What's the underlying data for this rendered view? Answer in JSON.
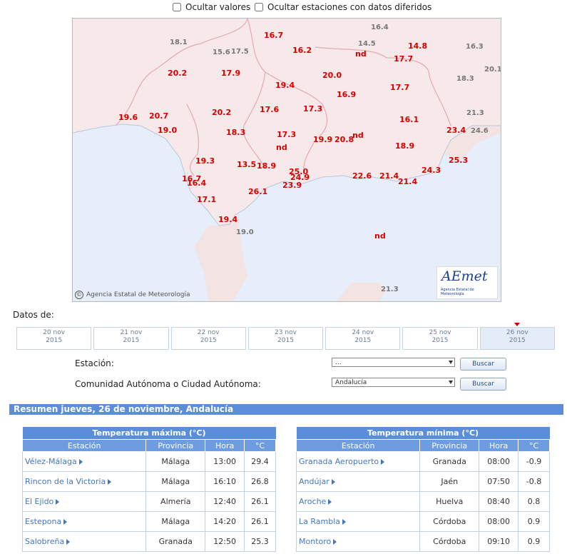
{
  "filters": {
    "hide_values": "Ocultar valores",
    "hide_stations": "Ocultar estaciones con datos diferidos"
  },
  "map": {
    "credit": "Agencia Estatal de Meteorología",
    "logo_text": "AEmet",
    "logo_sub": "Agencia Estatal de Meteorología",
    "values": [
      {
        "v": "16.7",
        "c": "red"
      },
      {
        "v": "14.5",
        "c": "gray"
      },
      {
        "v": "16.4",
        "c": "gray"
      },
      {
        "v": "14.8",
        "c": "red"
      },
      {
        "v": "18.1",
        "c": "gray"
      },
      {
        "v": "15.6",
        "c": "gray"
      },
      {
        "v": "17.5",
        "c": "gray"
      },
      {
        "v": "16.2",
        "c": "red"
      },
      {
        "v": "nd",
        "c": "red"
      },
      {
        "v": "17.7",
        "c": "red"
      },
      {
        "v": "16.3",
        "c": "gray"
      },
      {
        "v": "20.1",
        "c": "gray"
      },
      {
        "v": "20.2",
        "c": "red"
      },
      {
        "v": "17.9",
        "c": "red"
      },
      {
        "v": "20.0",
        "c": "red"
      },
      {
        "v": "18.3",
        "c": "gray"
      },
      {
        "v": "19.4",
        "c": "red"
      },
      {
        "v": "17.7",
        "c": "red"
      },
      {
        "v": "16.9",
        "c": "red"
      },
      {
        "v": "19.6",
        "c": "red"
      },
      {
        "v": "20.7",
        "c": "red"
      },
      {
        "v": "20.2",
        "c": "red"
      },
      {
        "v": "17.6",
        "c": "red"
      },
      {
        "v": "17.3",
        "c": "red"
      },
      {
        "v": "16.1",
        "c": "red"
      },
      {
        "v": "21.3",
        "c": "gray"
      },
      {
        "v": "19.0",
        "c": "red"
      },
      {
        "v": "18.3",
        "c": "red"
      },
      {
        "v": "17.3",
        "c": "red"
      },
      {
        "v": "19.9",
        "c": "red"
      },
      {
        "v": "20.8",
        "c": "red"
      },
      {
        "v": "nd",
        "c": "red"
      },
      {
        "v": "23.4",
        "c": "red"
      },
      {
        "v": "24.6",
        "c": "gray"
      },
      {
        "v": "nd",
        "c": "red"
      },
      {
        "v": "18.9",
        "c": "red"
      },
      {
        "v": "19.3",
        "c": "red"
      },
      {
        "v": "25.3",
        "c": "red"
      },
      {
        "v": "13.5",
        "c": "red"
      },
      {
        "v": "18.9",
        "c": "red"
      },
      {
        "v": "25.0",
        "c": "red"
      },
      {
        "v": "24.3",
        "c": "red"
      },
      {
        "v": "16.7",
        "c": "red"
      },
      {
        "v": "24.9",
        "c": "red"
      },
      {
        "v": "22.6",
        "c": "red"
      },
      {
        "v": "21.4",
        "c": "red"
      },
      {
        "v": "16.4",
        "c": "red"
      },
      {
        "v": "23.9",
        "c": "red"
      },
      {
        "v": "21.4",
        "c": "red"
      },
      {
        "v": "26.1",
        "c": "red"
      },
      {
        "v": "17.1",
        "c": "red"
      },
      {
        "v": "19.4",
        "c": "red"
      },
      {
        "v": "19.0",
        "c": "gray"
      },
      {
        "v": "nd",
        "c": "red"
      },
      {
        "v": "21.3",
        "c": "gray"
      }
    ]
  },
  "datos_label": "Datos de:",
  "dates": [
    {
      "d": "20 nov",
      "y": "2015"
    },
    {
      "d": "21 nov",
      "y": "2015"
    },
    {
      "d": "22 nov",
      "y": "2015"
    },
    {
      "d": "23 nov",
      "y": "2015"
    },
    {
      "d": "24 nov",
      "y": "2015"
    },
    {
      "d": "25 nov",
      "y": "2015"
    },
    {
      "d": "26 nov",
      "y": "2015"
    }
  ],
  "form": {
    "station_label": "Estación:",
    "station_value": "...",
    "community_label": "Comunidad Autónoma o Ciudad Autónoma:",
    "community_value": "Andalucía",
    "search_label": "Buscar"
  },
  "summary_title": "Resumen jueves, 26 de noviembre, Andalucía",
  "max_table": {
    "caption": "Temperatura máxima (°C)",
    "headers": [
      "Estación",
      "Provincia",
      "Hora",
      "°C"
    ],
    "rows": [
      [
        "Vélez-Málaga",
        "Málaga",
        "13:00",
        "29.4"
      ],
      [
        "Rincon de la Victoria",
        "Málaga",
        "16:10",
        "26.8"
      ],
      [
        "El Ejido",
        "Almería",
        "12:40",
        "26.1"
      ],
      [
        "Estepona",
        "Málaga",
        "14:20",
        "26.1"
      ],
      [
        "Salobreña",
        "Granada",
        "12:50",
        "25.3"
      ]
    ]
  },
  "min_table": {
    "caption": "Temperatura mínima (°C)",
    "headers": [
      "Estación",
      "Provincia",
      "Hora",
      "°C"
    ],
    "rows": [
      [
        "Granada Aeropuerto",
        "Granada",
        "08:00",
        "-0.9"
      ],
      [
        "Andújar",
        "Jaén",
        "07:50",
        "-0.8"
      ],
      [
        "Aroche",
        "Huelva",
        "08:40",
        "0.8"
      ],
      [
        "La Rambla",
        "Córdoba",
        "08:00",
        "0.9"
      ],
      [
        "Montoro",
        "Córdoba",
        "09:10",
        "0.9"
      ]
    ]
  }
}
